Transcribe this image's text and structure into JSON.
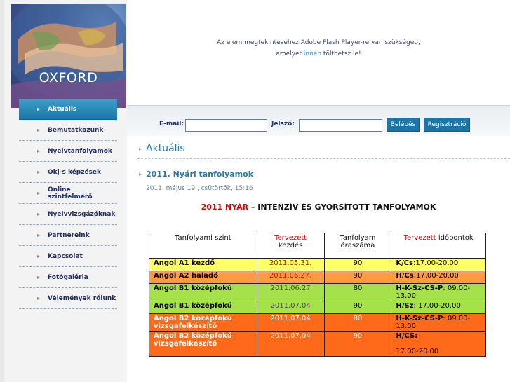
{
  "logo": {
    "text": "OXFORD"
  },
  "nav": {
    "items": [
      {
        "label": "Aktuális",
        "active": true
      },
      {
        "label": "Bemutatkozunk",
        "active": false
      },
      {
        "label": "Nyelvtanfolyamok",
        "active": false
      },
      {
        "label": "Okj-s képzések",
        "active": false
      },
      {
        "label": "Online szintfelmérő",
        "active": false
      },
      {
        "label": "Nyelvvizsgázóknak",
        "active": false
      },
      {
        "label": "Partnereink",
        "active": false
      },
      {
        "label": "Kapcsolat",
        "active": false
      },
      {
        "label": "Fotógaléria",
        "active": false
      },
      {
        "label": "Vélemények rólunk",
        "active": false
      }
    ]
  },
  "flash": {
    "line1": "Az elem megtekintéséhez Adobe Flash Player-re van szükséged,",
    "line2_before": "amelyet ",
    "line2_link": "innen",
    "line2_after": " tölthetsz le!"
  },
  "login": {
    "email_label": "E-mail:",
    "email_value": "",
    "password_label": "Jelszó:",
    "password_value": "",
    "login_button": "Belépés",
    "register_button": "Regisztráció"
  },
  "section": {
    "title": "Aktuális"
  },
  "post": {
    "title": "2011. Nyári tanfolyamok",
    "date": "2011. május 19., csütörtök, 15:16"
  },
  "course": {
    "heading_red": "2011 NYÁR",
    "heading_rest": " – INTENZÍV ÉS GYORSÍTOTT TANFOLYAMOK"
  },
  "table": {
    "headers": {
      "col1": "Tanfolyami szint",
      "col2_red": "Tervezett",
      "col2_rest": "kezdés",
      "col3_line1": "Tanfolyam",
      "col3_line2": "óraszáma",
      "col4_red": "Tervezett",
      "col4_rest": " időpontok"
    },
    "rows": [
      {
        "level": "Angol A1 kezdő",
        "start": "2011.05.31.",
        "hours": "90",
        "days": "K/Cs",
        "times": ":17.00-20.00"
      },
      {
        "level": "Angol A2 haladó",
        "start": "2011.06.27.",
        "hours": "90",
        "days": "H/Cs",
        "times": ":17.00-20.00"
      },
      {
        "level": "Angol B1 középfokú",
        "start": "2011.06.27",
        "hours": "80",
        "days": "H-K-Sz-CS-P",
        "times": ": 09.00-13.00"
      },
      {
        "level": "Angol B1 középfokú",
        "start": "2011.07.04",
        "hours": "90",
        "days": "H/Sz",
        "times": ": 17.00-20.00"
      },
      {
        "level": "Angol B2 középfokú vizsgafelkészítő",
        "start": "2011.07.04",
        "hours": "80",
        "days": "H-K-Sz-CS-P",
        "times": ": 09.00-13.00"
      },
      {
        "level": "Angol B2 középfokú vizsgafelkészítő",
        "start": "2011.07.04",
        "hours": "90",
        "days": "H/CS:",
        "times": "17.00-20.00"
      }
    ]
  },
  "colors": {
    "nav_active": "#1b76a8",
    "link_blue": "#2b7aa6",
    "red": "#e00000",
    "row_yellow": "#ffff66",
    "row_orange": "#ff9a40",
    "row_green": "#a6e04a",
    "row_deep_orange": "#ff6a1a"
  }
}
